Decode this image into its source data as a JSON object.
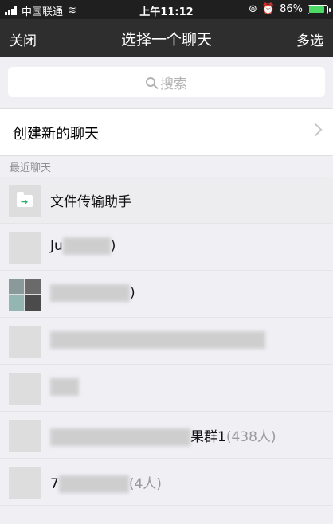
{
  "status_bar": {
    "carrier": "中国联通",
    "time": "上午11:12",
    "battery_percent": "86%",
    "battery_level": 0.86
  },
  "nav": {
    "close_label": "关闭",
    "title": "选择一个聊天",
    "multi_select_label": "多选"
  },
  "search": {
    "placeholder": "搜索"
  },
  "new_chat": {
    "label": "创建新的聊天"
  },
  "recent": {
    "section_label": "最近聊天",
    "items": [
      {
        "name": "文件传输助手",
        "count": ""
      },
      {
        "name_prefix": "Ju",
        "name_suffix": ")",
        "count": ""
      },
      {
        "name_prefix": "",
        "name_suffix": ")",
        "count": ""
      },
      {
        "name_prefix": "",
        "name_suffix": "",
        "count": ""
      },
      {
        "name_prefix": "",
        "name_suffix": "",
        "count": ""
      },
      {
        "name_prefix": "",
        "name_suffix": "果群1",
        "count": "(438人)"
      },
      {
        "name_prefix": "7",
        "name_suffix": "",
        "count": "(4人)"
      }
    ]
  }
}
